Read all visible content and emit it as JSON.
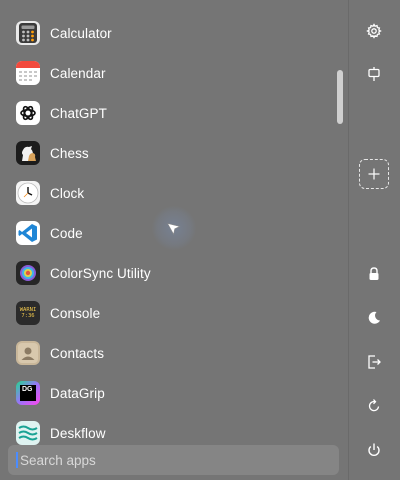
{
  "apps": [
    {
      "label": "Calculator",
      "icon": "calculator-icon"
    },
    {
      "label": "Calendar",
      "icon": "calendar-icon"
    },
    {
      "label": "ChatGPT",
      "icon": "chatgpt-icon"
    },
    {
      "label": "Chess",
      "icon": "chess-icon"
    },
    {
      "label": "Clock",
      "icon": "clock-icon"
    },
    {
      "label": "Code",
      "icon": "vscode-icon"
    },
    {
      "label": "ColorSync Utility",
      "icon": "colorsync-icon"
    },
    {
      "label": "Console",
      "icon": "console-icon",
      "icon_text": "WARNI\n7:36"
    },
    {
      "label": "Contacts",
      "icon": "contacts-icon"
    },
    {
      "label": "DataGrip",
      "icon": "datagrip-icon",
      "icon_text": "DG"
    },
    {
      "label": "Deskflow",
      "icon": "deskflow-icon"
    }
  ],
  "search": {
    "placeholder": "Search apps",
    "value": ""
  },
  "sidebar": {
    "top": [
      {
        "name": "settings",
        "icon": "gear-icon"
      },
      {
        "name": "pin",
        "icon": "pin-icon"
      }
    ],
    "add_slot": {
      "icon": "plus-icon"
    },
    "bottom": [
      {
        "name": "lock",
        "icon": "lock-icon"
      },
      {
        "name": "sleep",
        "icon": "moon-icon"
      },
      {
        "name": "logout",
        "icon": "logout-icon"
      },
      {
        "name": "restart",
        "icon": "restart-icon"
      },
      {
        "name": "shutdown",
        "icon": "power-icon"
      }
    ]
  },
  "colors": {
    "background": "#757575",
    "search_bg": "#858585",
    "text": "#ffffff",
    "accent": "#4a8cff"
  }
}
